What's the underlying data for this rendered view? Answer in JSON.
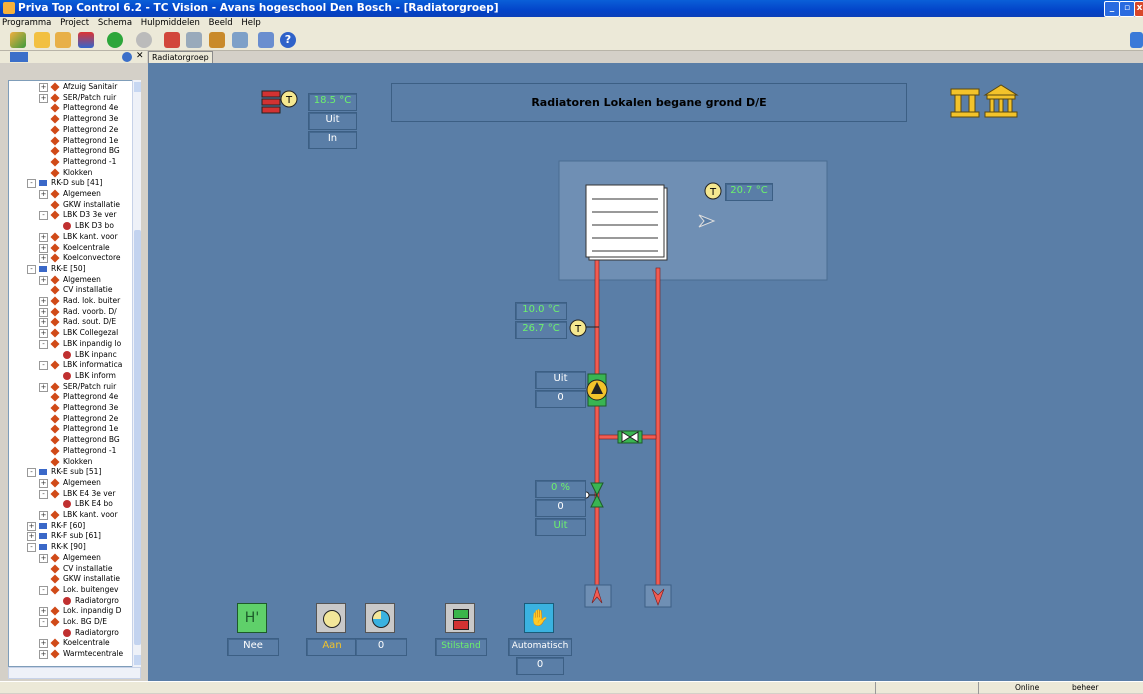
{
  "window": {
    "title": "Priva Top Control 6.2 - TC Vision - Avans hogeschool Den Bosch - [Radiatorgroep]"
  },
  "menu": [
    "Programma",
    "Project",
    "Schema",
    "Hulpmiddelen",
    "Beeld",
    "Help"
  ],
  "tab": {
    "label": "Radiatorgroep"
  },
  "tree": [
    {
      "label": "Afzuig Sanitair",
      "indent": 3,
      "icon": "d",
      "exp": "+"
    },
    {
      "label": "SER/Patch ruir",
      "indent": 3,
      "icon": "d",
      "exp": "+"
    },
    {
      "label": "Plattegrond 4e",
      "indent": 3,
      "icon": "d",
      "exp": ""
    },
    {
      "label": "Plattegrond 3e",
      "indent": 3,
      "icon": "d",
      "exp": ""
    },
    {
      "label": "Plattegrond 2e",
      "indent": 3,
      "icon": "d",
      "exp": ""
    },
    {
      "label": "Plattegrond 1e",
      "indent": 3,
      "icon": "d",
      "exp": ""
    },
    {
      "label": "Plattegrond BG",
      "indent": 3,
      "icon": "d",
      "exp": ""
    },
    {
      "label": "Plattegrond -1",
      "indent": 3,
      "icon": "d",
      "exp": ""
    },
    {
      "label": "Klokken",
      "indent": 3,
      "icon": "d",
      "exp": ""
    },
    {
      "label": "RK-D sub [41]",
      "indent": 2,
      "icon": "r",
      "exp": "-"
    },
    {
      "label": "Algemeen",
      "indent": 3,
      "icon": "d",
      "exp": "+"
    },
    {
      "label": "GKW installatie",
      "indent": 3,
      "icon": "d",
      "exp": ""
    },
    {
      "label": "LBK D3 3e ver",
      "indent": 3,
      "icon": "d",
      "exp": "-"
    },
    {
      "label": "LBK D3 bo",
      "indent": 4,
      "icon": "p",
      "exp": ""
    },
    {
      "label": "LBK kant. voor",
      "indent": 3,
      "icon": "d",
      "exp": "+"
    },
    {
      "label": "Koelcentrale",
      "indent": 3,
      "icon": "d",
      "exp": "+"
    },
    {
      "label": "Koelconvectore",
      "indent": 3,
      "icon": "d",
      "exp": "+"
    },
    {
      "label": "RK-E [50]",
      "indent": 2,
      "icon": "r",
      "exp": "-"
    },
    {
      "label": "Algemeen",
      "indent": 3,
      "icon": "d",
      "exp": "+"
    },
    {
      "label": "CV installatie",
      "indent": 3,
      "icon": "d",
      "exp": ""
    },
    {
      "label": "Rad. lok. buiter",
      "indent": 3,
      "icon": "d",
      "exp": "+"
    },
    {
      "label": "Rad. voorb. D/",
      "indent": 3,
      "icon": "d",
      "exp": "+"
    },
    {
      "label": "Rad. sout. D/E",
      "indent": 3,
      "icon": "d",
      "exp": "+"
    },
    {
      "label": "LBK Collegezal",
      "indent": 3,
      "icon": "d",
      "exp": "+"
    },
    {
      "label": "LBK inpandig lo",
      "indent": 3,
      "icon": "d",
      "exp": "-"
    },
    {
      "label": "LBK inpanc",
      "indent": 4,
      "icon": "p",
      "exp": ""
    },
    {
      "label": "LBK informatica",
      "indent": 3,
      "icon": "d",
      "exp": "-"
    },
    {
      "label": "LBK inform",
      "indent": 4,
      "icon": "p",
      "exp": ""
    },
    {
      "label": "SER/Patch ruir",
      "indent": 3,
      "icon": "d",
      "exp": "+"
    },
    {
      "label": "Plattegrond 4e",
      "indent": 3,
      "icon": "d",
      "exp": ""
    },
    {
      "label": "Plattegrond 3e",
      "indent": 3,
      "icon": "d",
      "exp": ""
    },
    {
      "label": "Plattegrond 2e",
      "indent": 3,
      "icon": "d",
      "exp": ""
    },
    {
      "label": "Plattegrond 1e",
      "indent": 3,
      "icon": "d",
      "exp": ""
    },
    {
      "label": "Plattegrond BG",
      "indent": 3,
      "icon": "d",
      "exp": ""
    },
    {
      "label": "Plattegrond -1",
      "indent": 3,
      "icon": "d",
      "exp": ""
    },
    {
      "label": "Klokken",
      "indent": 3,
      "icon": "d",
      "exp": ""
    },
    {
      "label": "RK-E sub [51]",
      "indent": 2,
      "icon": "r",
      "exp": "-"
    },
    {
      "label": "Algemeen",
      "indent": 3,
      "icon": "d",
      "exp": "+"
    },
    {
      "label": "LBK E4 3e ver",
      "indent": 3,
      "icon": "d",
      "exp": "-"
    },
    {
      "label": "LBK E4 bo",
      "indent": 4,
      "icon": "p",
      "exp": ""
    },
    {
      "label": "LBK kant. voor",
      "indent": 3,
      "icon": "d",
      "exp": "+"
    },
    {
      "label": "RK-F [60]",
      "indent": 2,
      "icon": "r",
      "exp": "+"
    },
    {
      "label": "RK-F sub [61]",
      "indent": 2,
      "icon": "r",
      "exp": "+"
    },
    {
      "label": "RK-K [90]",
      "indent": 2,
      "icon": "r",
      "exp": "-"
    },
    {
      "label": "Algemeen",
      "indent": 3,
      "icon": "d",
      "exp": "+"
    },
    {
      "label": "CV installatie",
      "indent": 3,
      "icon": "d",
      "exp": ""
    },
    {
      "label": "GKW installatie",
      "indent": 3,
      "icon": "d",
      "exp": ""
    },
    {
      "label": "Lok. buitengev",
      "indent": 3,
      "icon": "d",
      "exp": "-"
    },
    {
      "label": "Radiatorgro",
      "indent": 4,
      "icon": "p",
      "exp": ""
    },
    {
      "label": "Lok. inpandig D",
      "indent": 3,
      "icon": "d",
      "exp": "+"
    },
    {
      "label": "Lok. BG D/E",
      "indent": 3,
      "icon": "d",
      "exp": "-"
    },
    {
      "label": "Radiatorgro",
      "indent": 4,
      "icon": "p",
      "exp": ""
    },
    {
      "label": "Koelcentrale",
      "indent": 3,
      "icon": "d",
      "exp": "+"
    },
    {
      "label": "Warmtecentrale",
      "indent": 3,
      "icon": "d",
      "exp": "+"
    }
  ],
  "canvas": {
    "title": "Radiatoren Lokalen begane grond D/E",
    "outdoor": {
      "temp": "18.5 °C",
      "status1": "Uit",
      "status2": "In"
    },
    "room_temp": "20.7 °C",
    "supply": {
      "setpoint": "10.0 °C",
      "actual": "26.7 °C"
    },
    "pump": {
      "status": "Uit",
      "value": "0"
    },
    "valve": {
      "position": "0 %",
      "value": "0",
      "status": "Uit"
    },
    "controls": {
      "manual": "Nee",
      "clock": "Aan",
      "pie_value": "0",
      "state": "Stilstand",
      "mode": "Automatisch",
      "mode_value": "0"
    }
  },
  "status": {
    "online": "Online",
    "user": "beheer"
  },
  "colors": {
    "canvas": "#5a7ea7",
    "panel": "#6f8fb4",
    "pipe": "#f25c52",
    "value_text": "#6cf26c",
    "icon_gold": "#f3c32a"
  }
}
